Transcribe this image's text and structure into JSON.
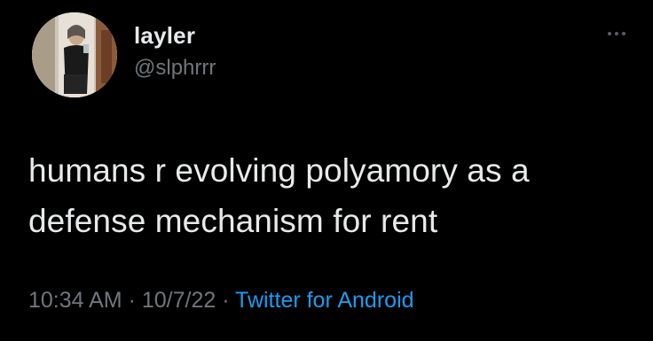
{
  "author": {
    "display_name": "layler",
    "handle": "@slphrrr",
    "avatar_icon": "profile-photo-avatar"
  },
  "menu": {
    "more_icon": "more-horizontal-icon"
  },
  "tweet": {
    "text": "humans r evolving polyamory as a\ndefense mechanism for rent"
  },
  "meta": {
    "time": "10:34 AM",
    "separator1": " · ",
    "date": "10/7/22",
    "separator2": " · ",
    "source": "Twitter for Android"
  },
  "colors": {
    "background": "#000000",
    "primary_text": "#e7e9ea",
    "secondary_text": "#71767b",
    "link": "#1d9bf0"
  }
}
